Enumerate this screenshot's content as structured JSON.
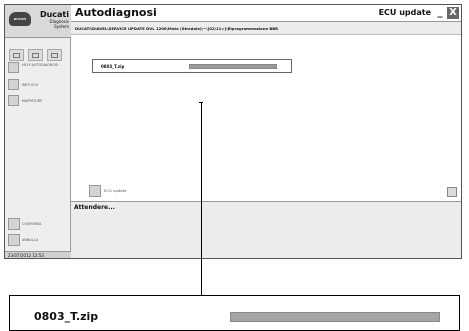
{
  "app": {
    "badge_text": "DUCATI",
    "brand_name": "Ducati",
    "brand_sub": "Diagnosis System",
    "title": "Autodiagnosi",
    "mode": "ECU update",
    "minimize_symbol": "_",
    "close_symbol": "X"
  },
  "path": "DUCATI\\DIAVEL\\SERVICE UPDATE DVL 1200\\Moto (Stradale)\\~\\[02/11>]\\Riprogrammazione BBR",
  "sidebar": {
    "items": [
      {
        "label": "HELP AUTODIAGNOSI"
      },
      {
        "label": "INFO ECU"
      },
      {
        "label": "MAPPATURE"
      }
    ],
    "confirm_label": "CONFERMA",
    "cancel_label": "ANNULLA",
    "datetime": "23/07/2012 12:53"
  },
  "file": {
    "name": "0803_T.zip",
    "progress": 1.0
  },
  "ecu_update_label": "ECU update",
  "status": "Attendere...",
  "zoom": {
    "name": "0803_T.zip",
    "progress": 1.0
  }
}
